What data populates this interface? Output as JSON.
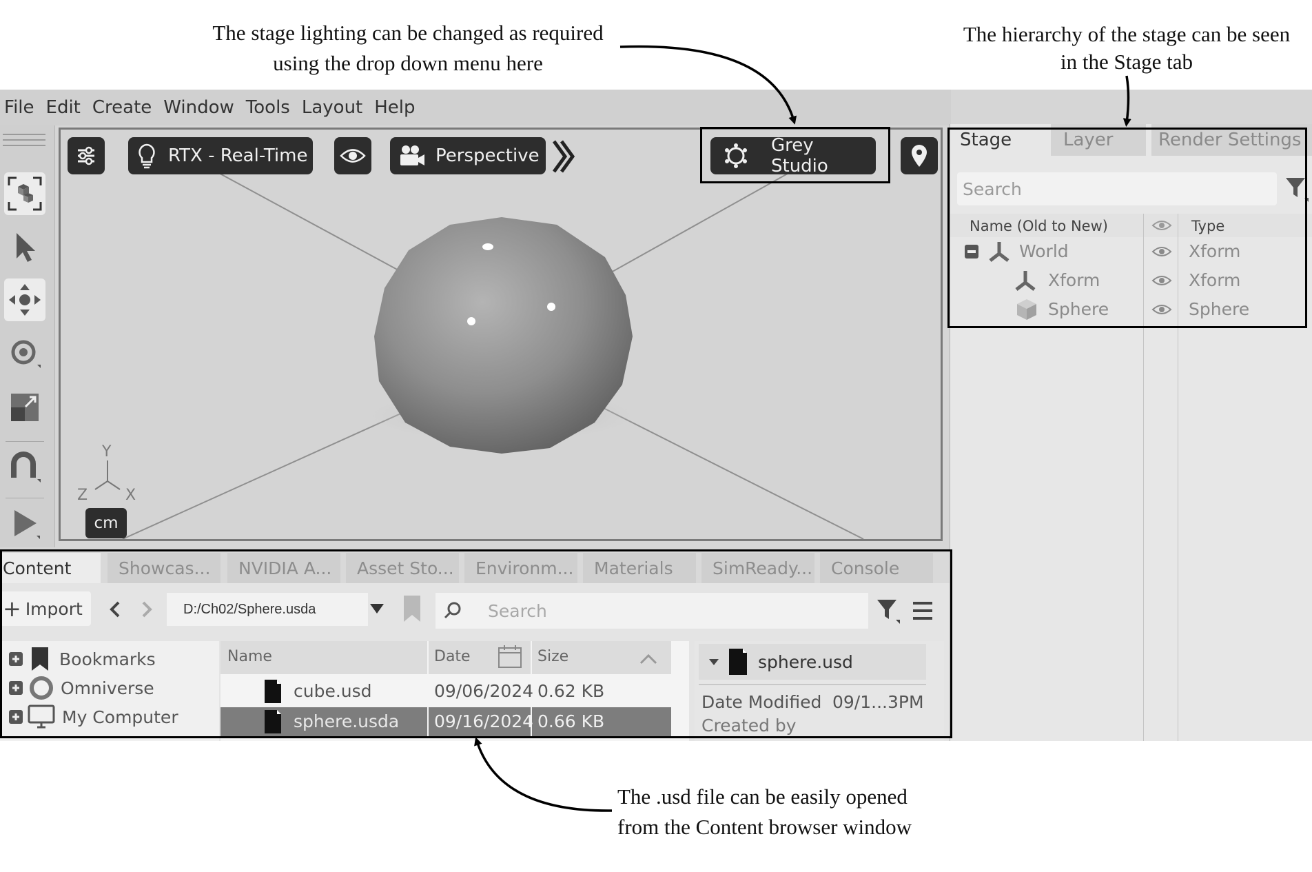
{
  "callouts": {
    "lighting_line1": "The stage lighting can be changed as required",
    "lighting_line2": "using the drop down menu here",
    "hierarchy_line1": "The hierarchy of the stage can be seen",
    "hierarchy_line2": "in the Stage tab",
    "content_line1": "The .usd file can be easily opened",
    "content_line2": "from the Content browser window"
  },
  "menu": [
    "File",
    "Edit",
    "Create",
    "Window",
    "Tools",
    "Layout",
    "Help"
  ],
  "viewport": {
    "render_mode": "RTX - Real-Time",
    "camera": "Perspective",
    "lighting": "Grey Studio",
    "units": "cm",
    "axis_y": "Y",
    "axis_z": "Z",
    "axis_x": "X"
  },
  "stage_panel": {
    "tabs": [
      "Stage",
      "Layer",
      "Render Settings"
    ],
    "search_placeholder": "Search",
    "col_name": "Name (Old to New)",
    "col_type": "Type",
    "rows": [
      {
        "name": "World",
        "type": "Xform"
      },
      {
        "name": "Xform",
        "type": "Xform"
      },
      {
        "name": "Sphere",
        "type": "Sphere"
      }
    ]
  },
  "content_panel": {
    "tabs": [
      "Content",
      "Showcas...",
      "NVIDIA A...",
      "Asset Sto...",
      "Environm...",
      "Materials",
      "SimReady...",
      "Console"
    ],
    "import_label": "Import",
    "path": "D:/Ch02/Sphere.usda",
    "search_placeholder": "Search",
    "tree": [
      "Bookmarks",
      "Omniverse",
      "My Computer"
    ],
    "col_name": "Name",
    "col_date": "Date",
    "col_size": "Size",
    "files": [
      {
        "name": "cube.usd",
        "date": "09/06/2024",
        "size": "0.62 KB"
      },
      {
        "name": "sphere.usda",
        "date": "09/16/2024",
        "size": "0.66 KB"
      }
    ],
    "detail_title": "sphere.usd",
    "date_modified_label": "Date Modified",
    "date_modified_value": "09/1...3PM",
    "created_by_label": "Created by"
  }
}
